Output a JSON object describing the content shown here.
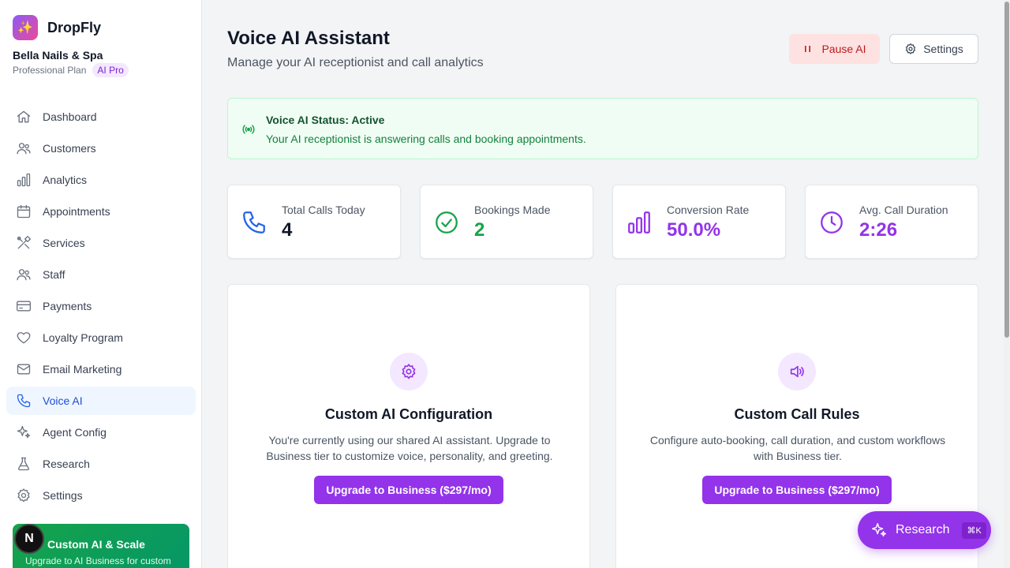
{
  "brand": {
    "name": "DropFly",
    "logo_glyph": "✨"
  },
  "business": {
    "name": "Bella Nails & Spa",
    "plan": "Professional Plan",
    "badge": "AI Pro"
  },
  "nav": {
    "items": [
      {
        "label": "Dashboard",
        "icon": "home-icon"
      },
      {
        "label": "Customers",
        "icon": "users-icon"
      },
      {
        "label": "Analytics",
        "icon": "bar-chart-icon"
      },
      {
        "label": "Appointments",
        "icon": "calendar-icon"
      },
      {
        "label": "Services",
        "icon": "tools-icon"
      },
      {
        "label": "Staff",
        "icon": "users-icon"
      },
      {
        "label": "Payments",
        "icon": "credit-card-icon"
      },
      {
        "label": "Loyalty Program",
        "icon": "heart-icon"
      },
      {
        "label": "Email Marketing",
        "icon": "mail-icon"
      },
      {
        "label": "Voice AI",
        "icon": "phone-icon",
        "active": true
      },
      {
        "label": "Agent Config",
        "icon": "sparkles-icon"
      },
      {
        "label": "Research",
        "icon": "flask-icon"
      },
      {
        "label": "Settings",
        "icon": "gear-icon"
      }
    ]
  },
  "promo": {
    "title": "Custom AI & Scale",
    "text": "Upgrade to AI Business for custom"
  },
  "next_badge": "N",
  "header": {
    "title": "Voice AI Assistant",
    "subtitle": "Manage your AI receptionist and call analytics",
    "pause_label": "Pause AI",
    "settings_label": "Settings"
  },
  "status": {
    "title": "Voice AI Status: Active",
    "text": "Your AI receptionist is answering calls and booking appointments."
  },
  "stats": [
    {
      "label": "Total Calls Today",
      "value": "4",
      "icon": "phone-icon",
      "color": "#111827"
    },
    {
      "label": "Bookings Made",
      "value": "2",
      "icon": "check-circle-icon",
      "color": "#16a34a"
    },
    {
      "label": "Conversion Rate",
      "value": "50.0%",
      "icon": "bar-chart-icon",
      "color": "#9333ea"
    },
    {
      "label": "Avg. Call Duration",
      "value": "2:26",
      "icon": "clock-icon",
      "color": "#9333ea"
    }
  ],
  "features": [
    {
      "title": "Custom AI Configuration",
      "text": "You're currently using our shared AI assistant. Upgrade to Business tier to customize voice, personality, and greeting.",
      "button": "Upgrade to Business ($297/mo)",
      "icon": "gear-icon"
    },
    {
      "title": "Custom Call Rules",
      "text": "Configure auto-booking, call duration, and custom workflows with Business tier.",
      "button": "Upgrade to Business ($297/mo)",
      "icon": "speaker-icon"
    }
  ],
  "research_fab": {
    "label": "Research",
    "shortcut": "⌘K"
  },
  "colors": {
    "accent": "#9333ea",
    "active_nav": "#2563eb",
    "success": "#16a34a",
    "danger": "#b91c1c"
  }
}
